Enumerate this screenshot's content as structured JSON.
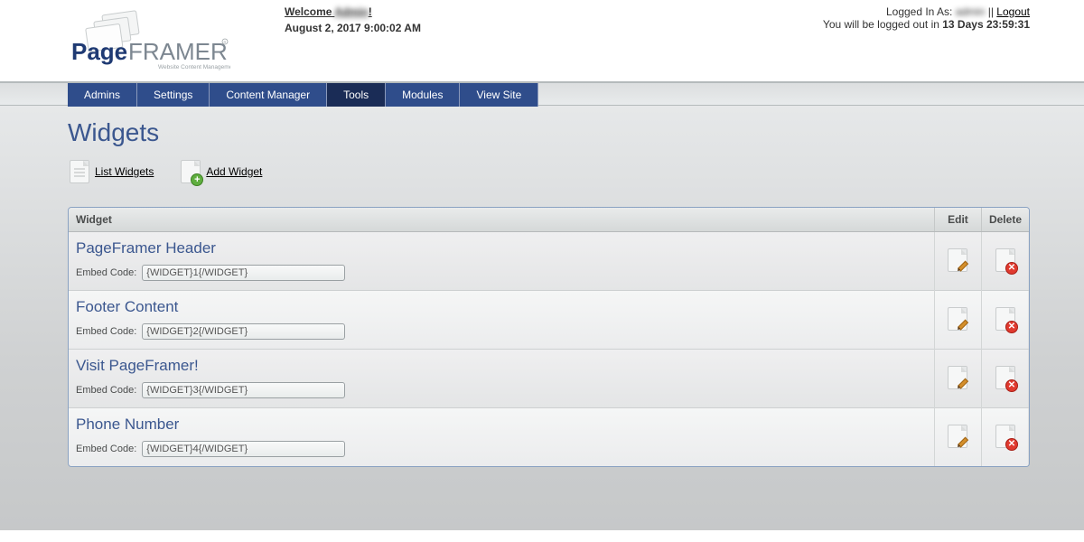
{
  "header": {
    "logo_line1": "Page",
    "logo_line2": "FRAMER",
    "logo_tag": "Website Content Management",
    "welcome_prefix": "Welcome ",
    "welcome_name": "Admin",
    "welcome_suffix": "!",
    "date": "August 2, 2017 9:00:02 AM",
    "logged_in_prefix": "Logged In As: ",
    "logged_in_name": "admin",
    "separator": " || ",
    "logout": "Logout",
    "session_prefix": "You will be logged out in ",
    "session_remaining": "13 Days 23:59:31"
  },
  "nav": {
    "items": [
      {
        "label": "Admins",
        "active": false
      },
      {
        "label": "Settings",
        "active": false
      },
      {
        "label": "Content Manager",
        "active": false
      },
      {
        "label": "Tools",
        "active": true
      },
      {
        "label": "Modules",
        "active": false
      },
      {
        "label": "View Site",
        "active": false
      }
    ]
  },
  "page": {
    "title": "Widgets",
    "actions": {
      "list": "List Widgets",
      "add": "Add Widget"
    }
  },
  "table": {
    "columns": {
      "widget": "Widget",
      "edit": "Edit",
      "delete": "Delete"
    },
    "embed_label": "Embed Code:",
    "rows": [
      {
        "name": "PageFramer Header",
        "embed": "{WIDGET}1{/WIDGET}"
      },
      {
        "name": "Footer Content",
        "embed": "{WIDGET}2{/WIDGET}"
      },
      {
        "name": "Visit PageFramer!",
        "embed": "{WIDGET}3{/WIDGET}"
      },
      {
        "name": "Phone Number",
        "embed": "{WIDGET}4{/WIDGET}"
      }
    ]
  }
}
